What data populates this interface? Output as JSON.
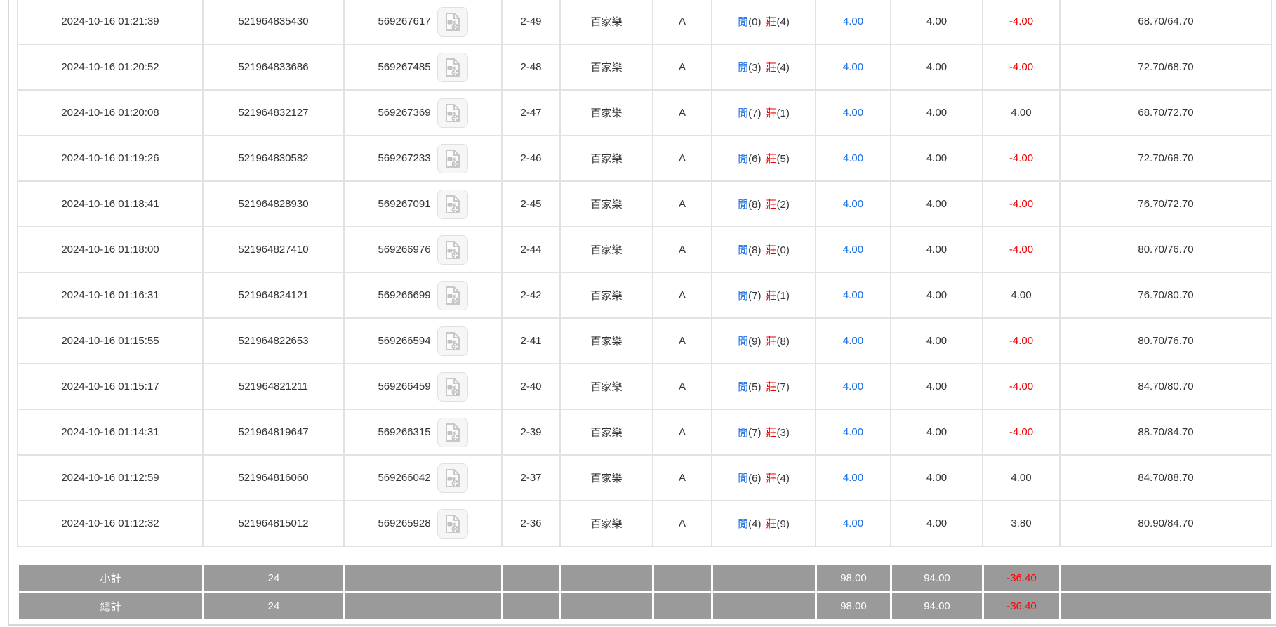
{
  "colors": {
    "accent_blue": "#1a6ee4",
    "accent_red": "#ee0000",
    "row_text": "#333333",
    "grid_line": "#e2e2e2",
    "summary_bg": "#9a9a9a",
    "summary_text": "#ffffff",
    "summary_negative": "#ff0000"
  },
  "result_labels": {
    "player": "閒",
    "banker": "莊"
  },
  "icons": {
    "video": "video-replay-icon"
  },
  "rows": [
    {
      "time": "2024-10-16 01:21:39",
      "bet_id": "521964835430",
      "game_id": "569267617",
      "round": "2-49",
      "game": "百家樂",
      "table": "A",
      "player": "0",
      "banker": "4",
      "bet": "4.00",
      "valid_bet": "4.00",
      "win_loss": "-4.00",
      "balance": "68.70/64.70"
    },
    {
      "time": "2024-10-16 01:20:52",
      "bet_id": "521964833686",
      "game_id": "569267485",
      "round": "2-48",
      "game": "百家樂",
      "table": "A",
      "player": "3",
      "banker": "4",
      "bet": "4.00",
      "valid_bet": "4.00",
      "win_loss": "-4.00",
      "balance": "72.70/68.70"
    },
    {
      "time": "2024-10-16 01:20:08",
      "bet_id": "521964832127",
      "game_id": "569267369",
      "round": "2-47",
      "game": "百家樂",
      "table": "A",
      "player": "7",
      "banker": "1",
      "bet": "4.00",
      "valid_bet": "4.00",
      "win_loss": "4.00",
      "balance": "68.70/72.70"
    },
    {
      "time": "2024-10-16 01:19:26",
      "bet_id": "521964830582",
      "game_id": "569267233",
      "round": "2-46",
      "game": "百家樂",
      "table": "A",
      "player": "6",
      "banker": "5",
      "bet": "4.00",
      "valid_bet": "4.00",
      "win_loss": "-4.00",
      "balance": "72.70/68.70"
    },
    {
      "time": "2024-10-16 01:18:41",
      "bet_id": "521964828930",
      "game_id": "569267091",
      "round": "2-45",
      "game": "百家樂",
      "table": "A",
      "player": "8",
      "banker": "2",
      "bet": "4.00",
      "valid_bet": "4.00",
      "win_loss": "-4.00",
      "balance": "76.70/72.70"
    },
    {
      "time": "2024-10-16 01:18:00",
      "bet_id": "521964827410",
      "game_id": "569266976",
      "round": "2-44",
      "game": "百家樂",
      "table": "A",
      "player": "8",
      "banker": "0",
      "bet": "4.00",
      "valid_bet": "4.00",
      "win_loss": "-4.00",
      "balance": "80.70/76.70"
    },
    {
      "time": "2024-10-16 01:16:31",
      "bet_id": "521964824121",
      "game_id": "569266699",
      "round": "2-42",
      "game": "百家樂",
      "table": "A",
      "player": "7",
      "banker": "1",
      "bet": "4.00",
      "valid_bet": "4.00",
      "win_loss": "4.00",
      "balance": "76.70/80.70"
    },
    {
      "time": "2024-10-16 01:15:55",
      "bet_id": "521964822653",
      "game_id": "569266594",
      "round": "2-41",
      "game": "百家樂",
      "table": "A",
      "player": "9",
      "banker": "8",
      "bet": "4.00",
      "valid_bet": "4.00",
      "win_loss": "-4.00",
      "balance": "80.70/76.70"
    },
    {
      "time": "2024-10-16 01:15:17",
      "bet_id": "521964821211",
      "game_id": "569266459",
      "round": "2-40",
      "game": "百家樂",
      "table": "A",
      "player": "5",
      "banker": "7",
      "bet": "4.00",
      "valid_bet": "4.00",
      "win_loss": "-4.00",
      "balance": "84.70/80.70"
    },
    {
      "time": "2024-10-16 01:14:31",
      "bet_id": "521964819647",
      "game_id": "569266315",
      "round": "2-39",
      "game": "百家樂",
      "table": "A",
      "player": "7",
      "banker": "3",
      "bet": "4.00",
      "valid_bet": "4.00",
      "win_loss": "-4.00",
      "balance": "88.70/84.70"
    },
    {
      "time": "2024-10-16 01:12:59",
      "bet_id": "521964816060",
      "game_id": "569266042",
      "round": "2-37",
      "game": "百家樂",
      "table": "A",
      "player": "6",
      "banker": "4",
      "bet": "4.00",
      "valid_bet": "4.00",
      "win_loss": "4.00",
      "balance": "84.70/88.70"
    },
    {
      "time": "2024-10-16 01:12:32",
      "bet_id": "521964815012",
      "game_id": "569265928",
      "round": "2-36",
      "game": "百家樂",
      "table": "A",
      "player": "4",
      "banker": "9",
      "bet": "4.00",
      "valid_bet": "4.00",
      "win_loss": "3.80",
      "balance": "80.90/84.70"
    }
  ],
  "summary": {
    "subtotal": {
      "label": "小計",
      "count": "24",
      "bet": "98.00",
      "valid_bet": "94.00",
      "win_loss": "-36.40"
    },
    "total": {
      "label": "總計",
      "count": "24",
      "bet": "98.00",
      "valid_bet": "94.00",
      "win_loss": "-36.40"
    }
  }
}
